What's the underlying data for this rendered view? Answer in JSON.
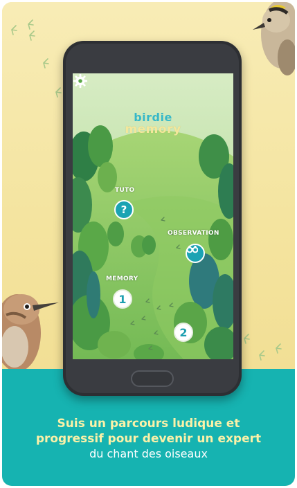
{
  "app": {
    "title_line1": "birdie",
    "title_line2": "memory"
  },
  "screen": {
    "settings_icon": "gear-icon",
    "levels": [
      {
        "label": "TUTO",
        "button": "?",
        "icon": "question-icon"
      },
      {
        "label": "OBSERVATION",
        "button": "",
        "icon": "binoculars-icon"
      },
      {
        "label": "MEMORY",
        "button": "1"
      },
      {
        "label": "",
        "button": "2"
      }
    ]
  },
  "caption": {
    "line1": "Suis un parcours ludique et",
    "line2": "progressif pour devenir un expert",
    "line3": "du chant des oiseaux"
  },
  "colors": {
    "background_paper": "#f4e49f",
    "banner_teal": "#16b3b1",
    "caption_yellow": "#fbf1a8",
    "button_teal": "#1ba3b3",
    "grass": "#86c66c"
  }
}
